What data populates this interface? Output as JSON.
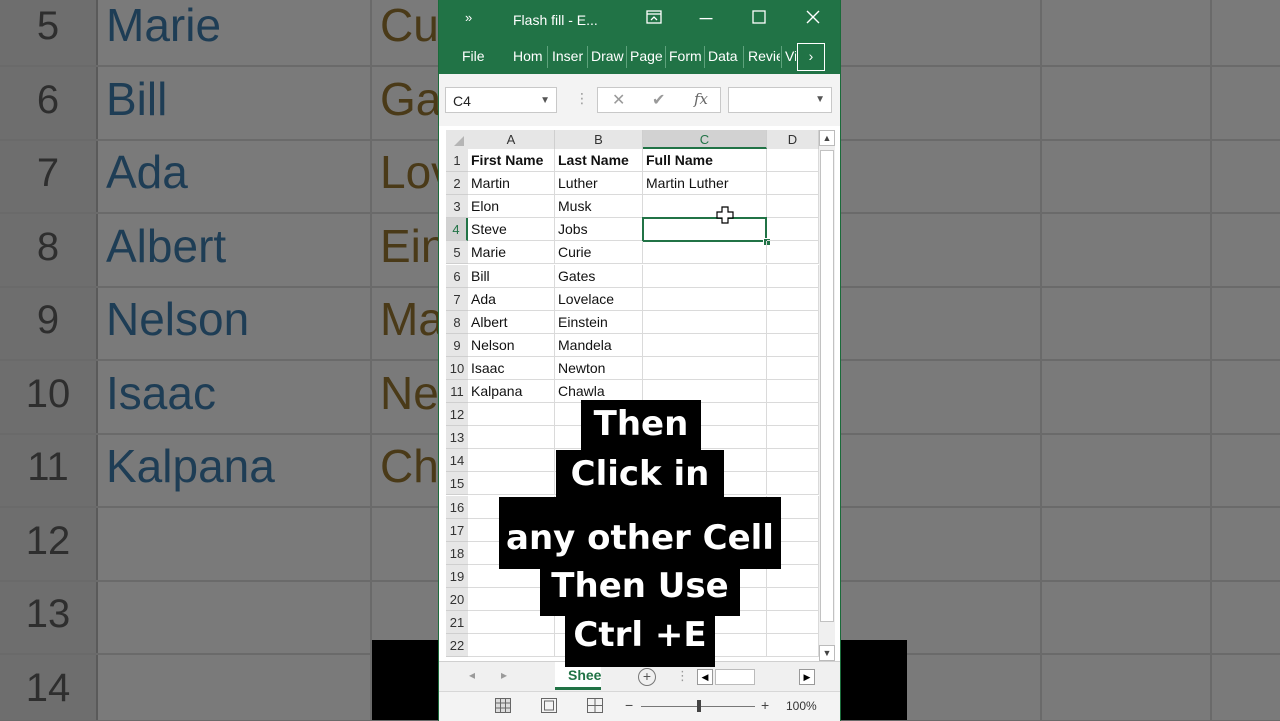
{
  "background": {
    "rows": [
      {
        "num": "5",
        "first": "Marie",
        "last": "Cu"
      },
      {
        "num": "6",
        "first": "Bill",
        "last": "Ga"
      },
      {
        "num": "7",
        "first": "Ada",
        "last": "Lov"
      },
      {
        "num": "8",
        "first": "Albert",
        "last": "Ein"
      },
      {
        "num": "9",
        "first": "Nelson",
        "last": "Ma"
      },
      {
        "num": "10",
        "first": "Isaac",
        "last": "Ne"
      },
      {
        "num": "11",
        "first": "Kalpana",
        "last": "Ch"
      },
      {
        "num": "12",
        "first": "",
        "last": ""
      },
      {
        "num": "13",
        "first": "",
        "last": ""
      },
      {
        "num": "14",
        "first": "",
        "last": ""
      }
    ]
  },
  "window": {
    "title": "Flash fill - E...",
    "qat_icon": "chevron-double-right-icon",
    "ribbon_tabs": [
      "File",
      "Hom",
      "Inser",
      "Draw",
      "Page",
      "Form",
      "Data",
      "Revie",
      "Vi"
    ],
    "more_tabs_icon": "chevron-right-icon"
  },
  "formula_bar": {
    "name_box": "C4",
    "formula": ""
  },
  "sheet": {
    "columns": [
      "A",
      "B",
      "C",
      "D"
    ],
    "selected_column": "C",
    "selected_row": "4",
    "active_cell": "C4",
    "rows": [
      {
        "num": "1",
        "a": "First Name",
        "b": "Last Name",
        "c": "Full Name"
      },
      {
        "num": "2",
        "a": "Martin",
        "b": "Luther",
        "c": "Martin Luther"
      },
      {
        "num": "3",
        "a": "Elon",
        "b": "Musk",
        "c": ""
      },
      {
        "num": "4",
        "a": "Steve",
        "b": "Jobs",
        "c": ""
      },
      {
        "num": "5",
        "a": "Marie",
        "b": "Curie",
        "c": ""
      },
      {
        "num": "6",
        "a": "Bill",
        "b": "Gates",
        "c": ""
      },
      {
        "num": "7",
        "a": "Ada",
        "b": "Lovelace",
        "c": ""
      },
      {
        "num": "8",
        "a": "Albert",
        "b": "Einstein",
        "c": ""
      },
      {
        "num": "9",
        "a": "Nelson",
        "b": "Mandela",
        "c": ""
      },
      {
        "num": "10",
        "a": "Isaac",
        "b": "Newton",
        "c": ""
      },
      {
        "num": "11",
        "a": "Kalpana",
        "b": "Chawla",
        "c": ""
      },
      {
        "num": "12",
        "a": "",
        "b": "",
        "c": ""
      },
      {
        "num": "13",
        "a": "",
        "b": "",
        "c": ""
      },
      {
        "num": "14",
        "a": "",
        "b": "",
        "c": ""
      },
      {
        "num": "15",
        "a": "",
        "b": "",
        "c": ""
      },
      {
        "num": "16",
        "a": "",
        "b": "",
        "c": ""
      },
      {
        "num": "17",
        "a": "",
        "b": "",
        "c": ""
      },
      {
        "num": "18",
        "a": "",
        "b": "",
        "c": ""
      },
      {
        "num": "19",
        "a": "",
        "b": "",
        "c": ""
      },
      {
        "num": "20",
        "a": "",
        "b": "",
        "c": ""
      },
      {
        "num": "21",
        "a": "",
        "b": "",
        "c": ""
      },
      {
        "num": "22",
        "a": "",
        "b": "",
        "c": ""
      }
    ]
  },
  "tabs_bar": {
    "sheet_tab": "Shee",
    "add_sheet": "+"
  },
  "status_bar": {
    "zoom": "100%",
    "zoom_minus": "−",
    "zoom_plus": "+"
  },
  "caption": {
    "lines": [
      "Then",
      "Click in",
      "any other Cell",
      "Then Use",
      "Ctrl +E"
    ]
  },
  "colors": {
    "excel_green": "#217346",
    "caption_bg": "#000000",
    "caption_text": "#ffffff"
  }
}
